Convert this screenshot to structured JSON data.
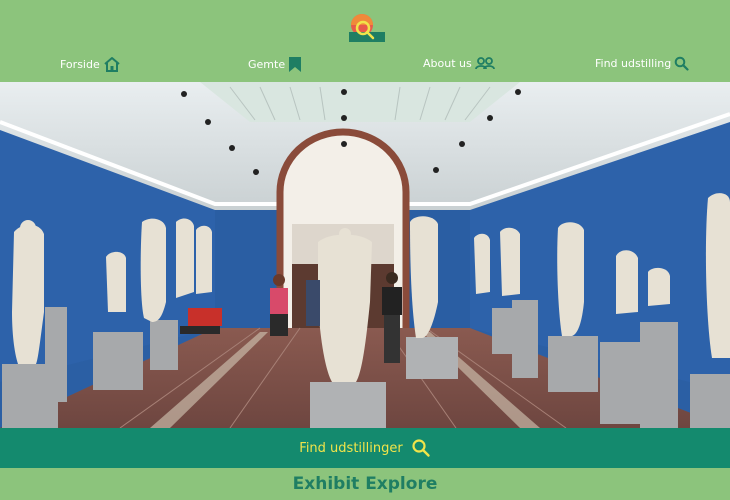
{
  "colors": {
    "header_bg": "#8cc47c",
    "nav_text": "#ffffff",
    "nav_icon": "#1f7e63",
    "cta_bg": "#148a6e",
    "cta_text": "#f1e44a",
    "footer_title": "#1f7e63"
  },
  "header": {
    "logo_icon": "sunset-magnifier-logo-icon",
    "nav": [
      {
        "label": "Forside",
        "icon": "home-icon"
      },
      {
        "label": "Gemte",
        "icon": "bookmark-icon"
      },
      {
        "label": "About us",
        "icon": "users-icon"
      },
      {
        "label": "Find udstilling",
        "icon": "search-icon"
      }
    ]
  },
  "hero": {
    "image_subject": "museum-sculpture-gallery"
  },
  "cta": {
    "label": "Find udstillinger",
    "icon": "search-icon"
  },
  "footer": {
    "title": "Exhibit Explore"
  }
}
